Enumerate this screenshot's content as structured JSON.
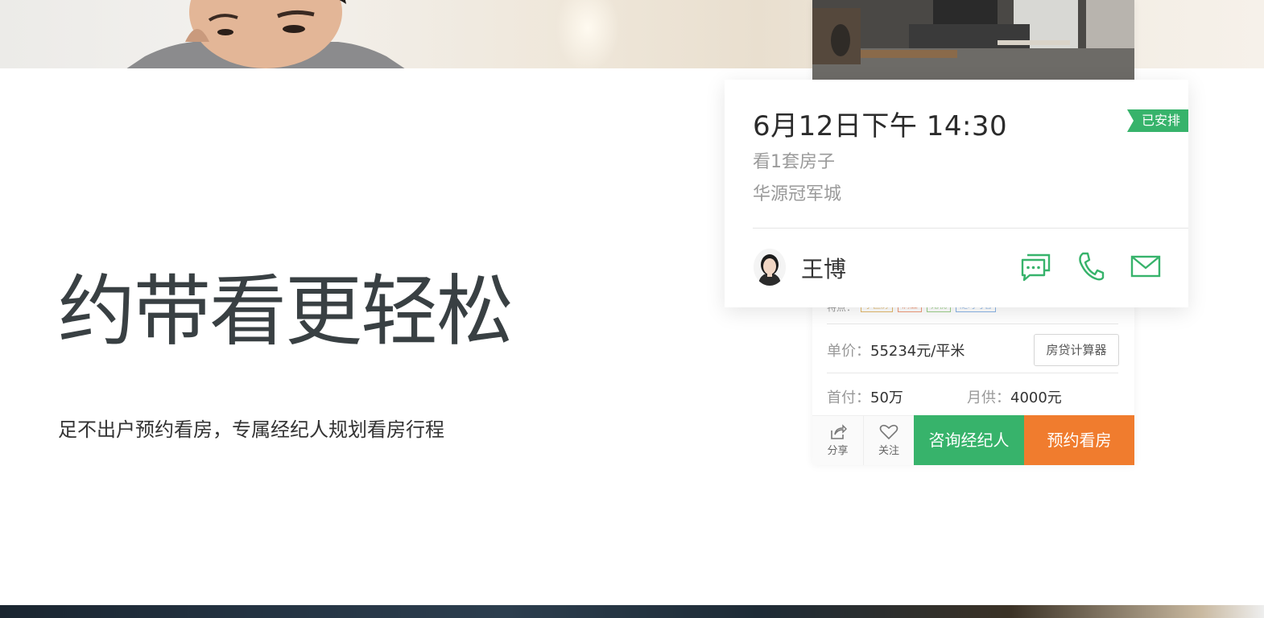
{
  "hero": {
    "headline": "约带看更轻松",
    "subline": "足不出户预约看房，专属经纪人规划看房行程"
  },
  "schedule_card": {
    "time": "6月12日下午 14:30",
    "status": "已安排",
    "house_count": "看1套房子",
    "community": "华源冠军城",
    "agent_name": "王博",
    "icons": [
      "chat-icon",
      "phone-icon",
      "mail-icon"
    ]
  },
  "listing": {
    "features_label": "特点：",
    "tags": [
      "学区房",
      "满五",
      "无税",
      "随时可看"
    ],
    "unit_price_label": "单价：",
    "unit_price": "55234元/平米",
    "calc_button": "房贷计算器",
    "down_payment_label": "首付：",
    "down_payment": "50万",
    "monthly_label": "月供：",
    "monthly": "4000元",
    "share_label": "分享",
    "follow_label": "关注",
    "consult_button": "咨询经纪人",
    "book_button": "预约看房"
  },
  "colors": {
    "green": "#37b36b",
    "orange": "#f07c2e",
    "headline": "#394043"
  }
}
